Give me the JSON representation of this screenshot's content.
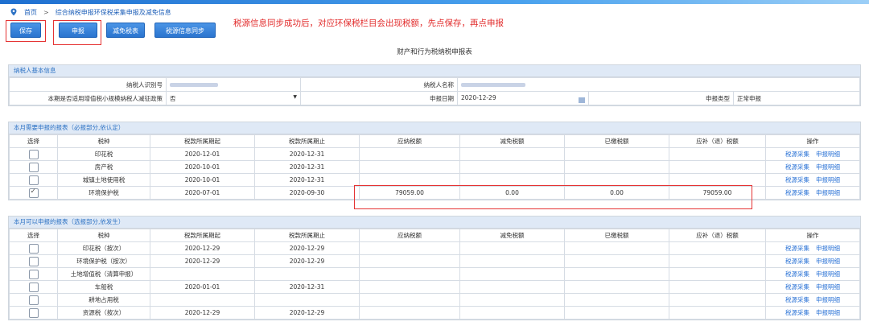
{
  "breadcrumb": {
    "home": "首页",
    "separator": ">",
    "current": "综合纳税申报环保税采集申报及减免信息"
  },
  "toolbar": {
    "save": "保存",
    "declare": "申报",
    "reduce_tax": "减免税表",
    "sync": "税源信息同步"
  },
  "notice": "税源信息同步成功后，对应环保税栏目会出现税额，先点保存，再点申报",
  "title": "财产和行为税纳税申报表",
  "basic": {
    "section": "纳税人基本信息",
    "taxpayer_id_label": "纳税人识别号",
    "taxpayer_name_label": "纳税人名称",
    "policy_label": "本期是否适用增值税小规模纳税人减征政策",
    "policy_value": "否",
    "declare_date_label": "申报日期",
    "declare_date_value": "2020-12-29",
    "declare_type_label": "申报类型",
    "declare_type_value": "正常申报"
  },
  "required": {
    "section": "本月需要申报的报表（必报部分,依认定）",
    "headers": [
      "选择",
      "税种",
      "税款所属期起",
      "税款所属期止",
      "应纳税额",
      "减免税额",
      "已缴税额",
      "应补（退）税额",
      "操作"
    ],
    "rows": [
      {
        "checked": false,
        "tax": "印花税",
        "start": "2020-12-01",
        "end": "2020-12-31",
        "due": "",
        "reduce": "",
        "paid": "",
        "payable": ""
      },
      {
        "checked": false,
        "tax": "房产税",
        "start": "2020-10-01",
        "end": "2020-12-31",
        "due": "",
        "reduce": "",
        "paid": "",
        "payable": ""
      },
      {
        "checked": false,
        "tax": "城镇土地使用税",
        "start": "2020-10-01",
        "end": "2020-12-31",
        "due": "",
        "reduce": "",
        "paid": "",
        "payable": ""
      },
      {
        "checked": true,
        "tax": "环境保护税",
        "start": "2020-07-01",
        "end": "2020-09-30",
        "due": "79059.00",
        "reduce": "0.00",
        "paid": "0.00",
        "payable": "79059.00"
      }
    ],
    "op1": "税源采集",
    "op2": "申报明细"
  },
  "optional": {
    "section": "本月可以申报的报表（选报部分,依发生）",
    "headers": [
      "选择",
      "税种",
      "税款所属期起",
      "税款所属期止",
      "应纳税额",
      "减免税额",
      "已缴税额",
      "应补（退）税额",
      "操作"
    ],
    "rows": [
      {
        "tax": "印花税（按次）",
        "start": "2020-12-29",
        "end": "2020-12-29"
      },
      {
        "tax": "环境保护税（按次）",
        "start": "2020-12-29",
        "end": "2020-12-29"
      },
      {
        "tax": "土地增值税（清算申报）",
        "start": "",
        "end": ""
      },
      {
        "tax": "车船税",
        "start": "2020-01-01",
        "end": "2020-12-31"
      },
      {
        "tax": "耕地占用税",
        "start": "",
        "end": ""
      },
      {
        "tax": "资源税（按次）",
        "start": "2020-12-29",
        "end": "2020-12-29"
      }
    ],
    "op1": "税源采集",
    "op2": "申报明细"
  },
  "colors": {
    "accent": "#2a74cf",
    "highlight": "#e53333"
  }
}
